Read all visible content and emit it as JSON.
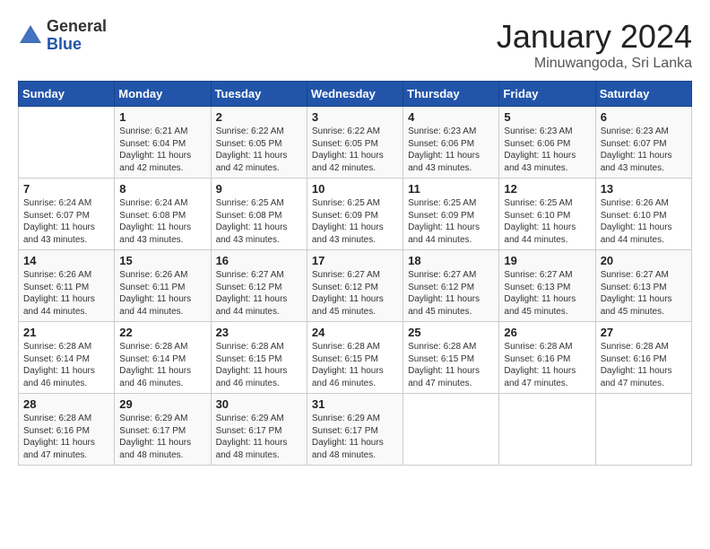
{
  "header": {
    "logo_general": "General",
    "logo_blue": "Blue",
    "month_title": "January 2024",
    "location": "Minuwangoda, Sri Lanka"
  },
  "calendar": {
    "days_of_week": [
      "Sunday",
      "Monday",
      "Tuesday",
      "Wednesday",
      "Thursday",
      "Friday",
      "Saturday"
    ],
    "weeks": [
      [
        {
          "day": "",
          "info": ""
        },
        {
          "day": "1",
          "info": "Sunrise: 6:21 AM\nSunset: 6:04 PM\nDaylight: 11 hours\nand 42 minutes."
        },
        {
          "day": "2",
          "info": "Sunrise: 6:22 AM\nSunset: 6:05 PM\nDaylight: 11 hours\nand 42 minutes."
        },
        {
          "day": "3",
          "info": "Sunrise: 6:22 AM\nSunset: 6:05 PM\nDaylight: 11 hours\nand 42 minutes."
        },
        {
          "day": "4",
          "info": "Sunrise: 6:23 AM\nSunset: 6:06 PM\nDaylight: 11 hours\nand 43 minutes."
        },
        {
          "day": "5",
          "info": "Sunrise: 6:23 AM\nSunset: 6:06 PM\nDaylight: 11 hours\nand 43 minutes."
        },
        {
          "day": "6",
          "info": "Sunrise: 6:23 AM\nSunset: 6:07 PM\nDaylight: 11 hours\nand 43 minutes."
        }
      ],
      [
        {
          "day": "7",
          "info": "Sunrise: 6:24 AM\nSunset: 6:07 PM\nDaylight: 11 hours\nand 43 minutes."
        },
        {
          "day": "8",
          "info": "Sunrise: 6:24 AM\nSunset: 6:08 PM\nDaylight: 11 hours\nand 43 minutes."
        },
        {
          "day": "9",
          "info": "Sunrise: 6:25 AM\nSunset: 6:08 PM\nDaylight: 11 hours\nand 43 minutes."
        },
        {
          "day": "10",
          "info": "Sunrise: 6:25 AM\nSunset: 6:09 PM\nDaylight: 11 hours\nand 43 minutes."
        },
        {
          "day": "11",
          "info": "Sunrise: 6:25 AM\nSunset: 6:09 PM\nDaylight: 11 hours\nand 44 minutes."
        },
        {
          "day": "12",
          "info": "Sunrise: 6:25 AM\nSunset: 6:10 PM\nDaylight: 11 hours\nand 44 minutes."
        },
        {
          "day": "13",
          "info": "Sunrise: 6:26 AM\nSunset: 6:10 PM\nDaylight: 11 hours\nand 44 minutes."
        }
      ],
      [
        {
          "day": "14",
          "info": "Sunrise: 6:26 AM\nSunset: 6:11 PM\nDaylight: 11 hours\nand 44 minutes."
        },
        {
          "day": "15",
          "info": "Sunrise: 6:26 AM\nSunset: 6:11 PM\nDaylight: 11 hours\nand 44 minutes."
        },
        {
          "day": "16",
          "info": "Sunrise: 6:27 AM\nSunset: 6:12 PM\nDaylight: 11 hours\nand 44 minutes."
        },
        {
          "day": "17",
          "info": "Sunrise: 6:27 AM\nSunset: 6:12 PM\nDaylight: 11 hours\nand 45 minutes."
        },
        {
          "day": "18",
          "info": "Sunrise: 6:27 AM\nSunset: 6:12 PM\nDaylight: 11 hours\nand 45 minutes."
        },
        {
          "day": "19",
          "info": "Sunrise: 6:27 AM\nSunset: 6:13 PM\nDaylight: 11 hours\nand 45 minutes."
        },
        {
          "day": "20",
          "info": "Sunrise: 6:27 AM\nSunset: 6:13 PM\nDaylight: 11 hours\nand 45 minutes."
        }
      ],
      [
        {
          "day": "21",
          "info": "Sunrise: 6:28 AM\nSunset: 6:14 PM\nDaylight: 11 hours\nand 46 minutes."
        },
        {
          "day": "22",
          "info": "Sunrise: 6:28 AM\nSunset: 6:14 PM\nDaylight: 11 hours\nand 46 minutes."
        },
        {
          "day": "23",
          "info": "Sunrise: 6:28 AM\nSunset: 6:15 PM\nDaylight: 11 hours\nand 46 minutes."
        },
        {
          "day": "24",
          "info": "Sunrise: 6:28 AM\nSunset: 6:15 PM\nDaylight: 11 hours\nand 46 minutes."
        },
        {
          "day": "25",
          "info": "Sunrise: 6:28 AM\nSunset: 6:15 PM\nDaylight: 11 hours\nand 47 minutes."
        },
        {
          "day": "26",
          "info": "Sunrise: 6:28 AM\nSunset: 6:16 PM\nDaylight: 11 hours\nand 47 minutes."
        },
        {
          "day": "27",
          "info": "Sunrise: 6:28 AM\nSunset: 6:16 PM\nDaylight: 11 hours\nand 47 minutes."
        }
      ],
      [
        {
          "day": "28",
          "info": "Sunrise: 6:28 AM\nSunset: 6:16 PM\nDaylight: 11 hours\nand 47 minutes."
        },
        {
          "day": "29",
          "info": "Sunrise: 6:29 AM\nSunset: 6:17 PM\nDaylight: 11 hours\nand 48 minutes."
        },
        {
          "day": "30",
          "info": "Sunrise: 6:29 AM\nSunset: 6:17 PM\nDaylight: 11 hours\nand 48 minutes."
        },
        {
          "day": "31",
          "info": "Sunrise: 6:29 AM\nSunset: 6:17 PM\nDaylight: 11 hours\nand 48 minutes."
        },
        {
          "day": "",
          "info": ""
        },
        {
          "day": "",
          "info": ""
        },
        {
          "day": "",
          "info": ""
        }
      ]
    ]
  }
}
